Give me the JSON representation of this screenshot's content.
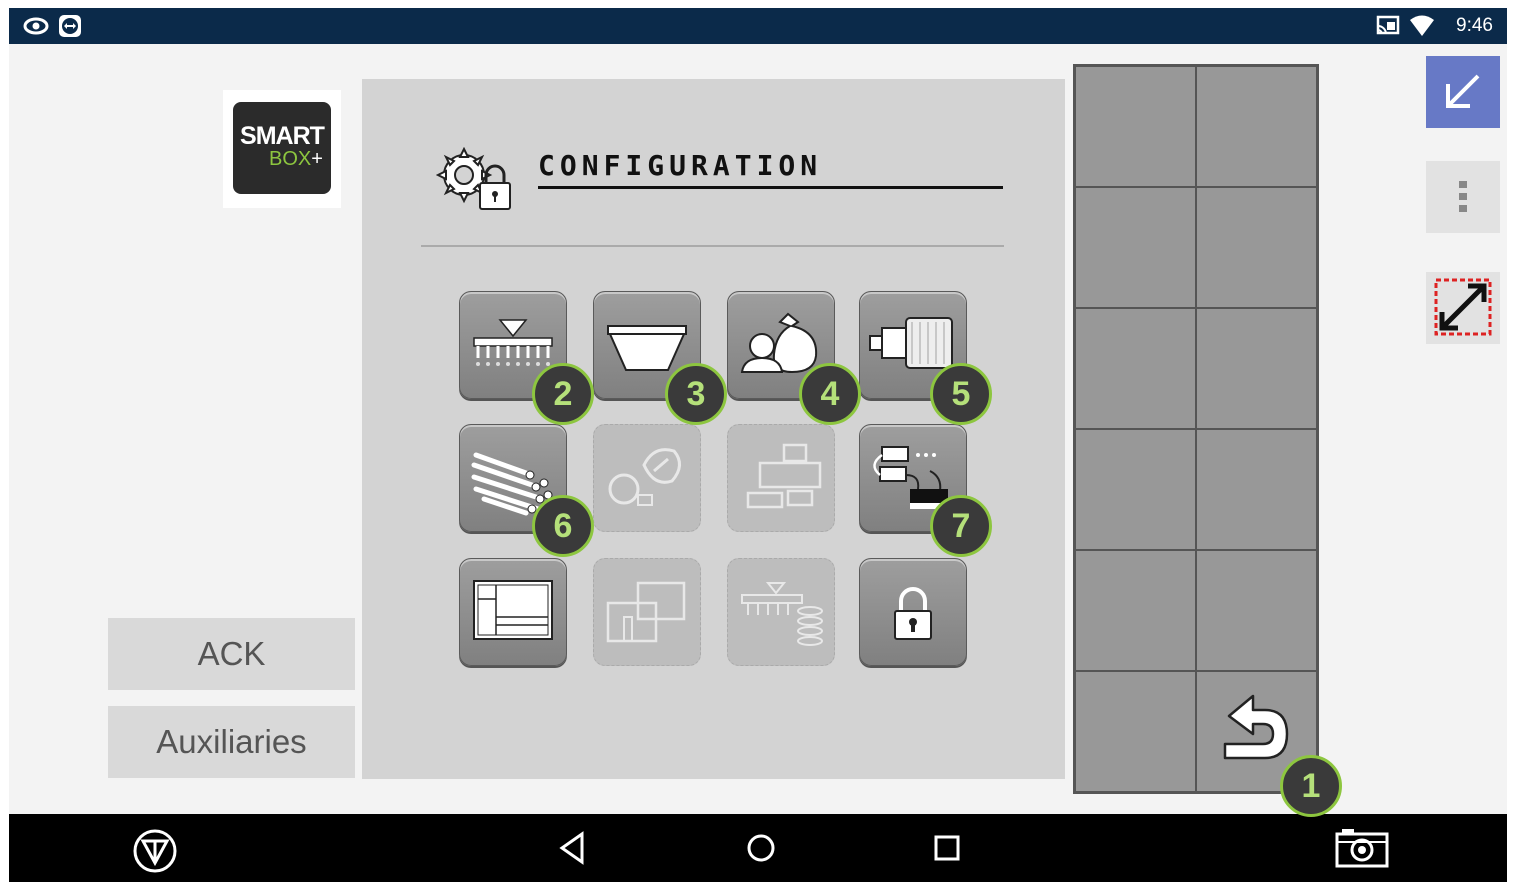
{
  "status_bar": {
    "time": "9:46",
    "left_icons": [
      "eye-icon",
      "teamviewer-icon"
    ],
    "right_icons": [
      "cast-icon",
      "wifi-icon"
    ]
  },
  "logo": {
    "line1": "SMART",
    "line2": "BOX",
    "plus": "+"
  },
  "left_buttons": {
    "ack": "ACK",
    "auxiliaries": "Auxiliaries"
  },
  "panel": {
    "title": "CONFIGURATION",
    "tiles": [
      {
        "icon": "seed-drill-icon",
        "enabled": true,
        "badge": "2"
      },
      {
        "icon": "hopper-icon",
        "enabled": true,
        "badge": "3"
      },
      {
        "icon": "operator-seed-bag-icon",
        "enabled": true,
        "badge": "4"
      },
      {
        "icon": "motor-icon",
        "enabled": true,
        "badge": "5"
      },
      {
        "icon": "pipes-icon",
        "enabled": true,
        "badge": "6"
      },
      {
        "icon": "calibration-disabled-icon",
        "enabled": false,
        "badge": ""
      },
      {
        "icon": "machine-layout-disabled-icon",
        "enabled": false,
        "badge": ""
      },
      {
        "icon": "sensor-connection-icon",
        "enabled": true,
        "badge": "7"
      },
      {
        "icon": "display-layout-icon",
        "enabled": true,
        "badge": ""
      },
      {
        "icon": "multi-screen-disabled-icon",
        "enabled": false,
        "badge": ""
      },
      {
        "icon": "drill-sections-disabled-icon",
        "enabled": false,
        "badge": ""
      },
      {
        "icon": "lock-icon",
        "enabled": true,
        "badge": ""
      }
    ]
  },
  "right_grid": {
    "back_badge": "1"
  },
  "right_tools": [
    "minimize-icon",
    "more-vert-icon",
    "resize-icon"
  ],
  "nav_bar": [
    "isobus-icon",
    "back-icon",
    "home-icon",
    "recents-icon",
    "screenshot-icon"
  ],
  "colors": {
    "status_bar": "#0b2a4a",
    "accent_blue": "#6779c6",
    "badge_green": "#8dc63f",
    "panel": "#d3d3d3",
    "grid_cell": "#989898"
  }
}
